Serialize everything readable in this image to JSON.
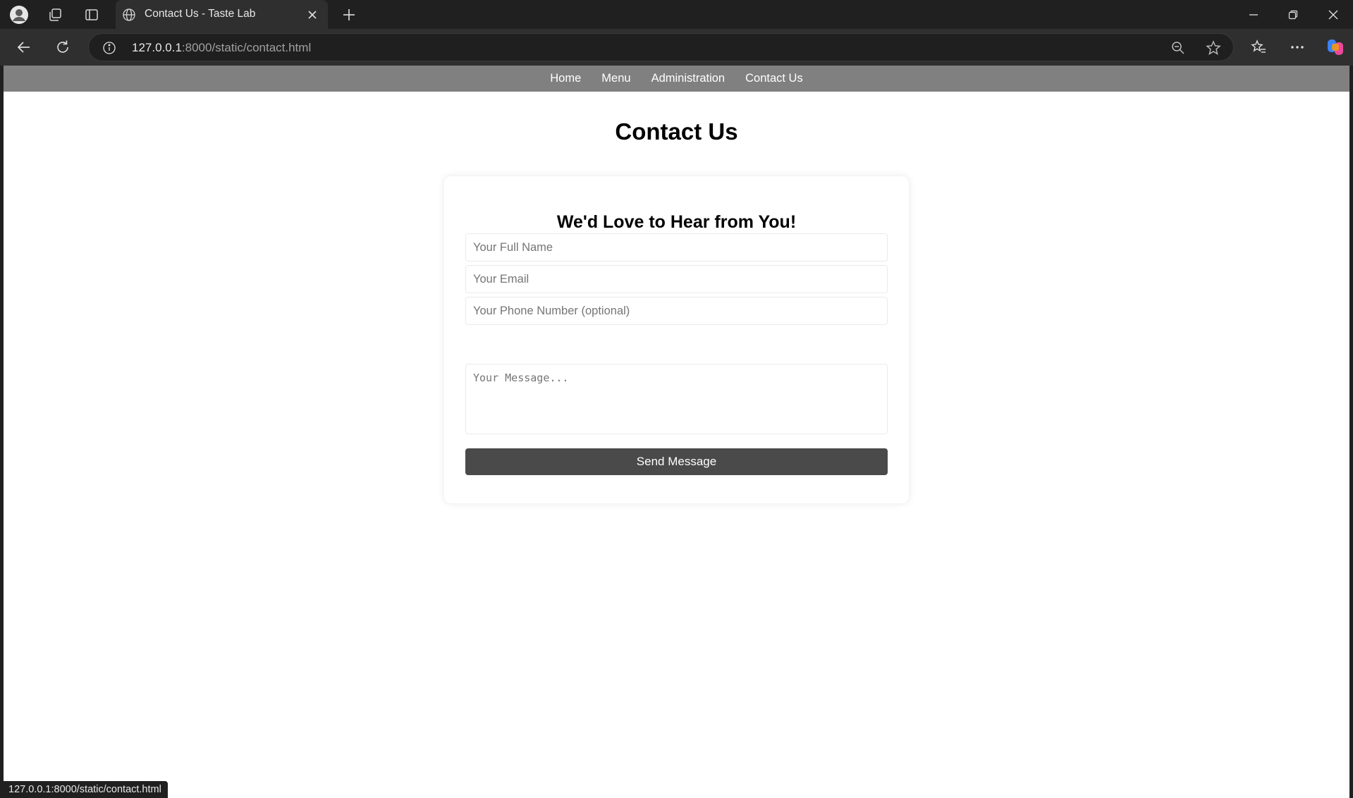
{
  "browser": {
    "tab_title": "Contact Us - Taste Lab",
    "url_host": "127.0.0.1",
    "url_rest": ":8000/static/contact.html",
    "status_url": "127.0.0.1:8000/static/contact.html"
  },
  "nav": {
    "items": [
      {
        "label": "Home"
      },
      {
        "label": "Menu"
      },
      {
        "label": "Administration"
      },
      {
        "label": "Contact Us"
      }
    ]
  },
  "page": {
    "title": "Contact Us"
  },
  "form": {
    "heading": "We'd Love to Hear from You!",
    "name_placeholder": "Your Full Name",
    "email_placeholder": "Your Email",
    "phone_placeholder": "Your Phone Number (optional)",
    "message_placeholder": "Your Message...",
    "name_value": "",
    "email_value": "",
    "phone_value": "",
    "message_value": "",
    "submit_label": "Send Message"
  },
  "colors": {
    "nav_background": "#808080",
    "button_background": "#4a4a4a",
    "chrome_background": "#202020"
  }
}
